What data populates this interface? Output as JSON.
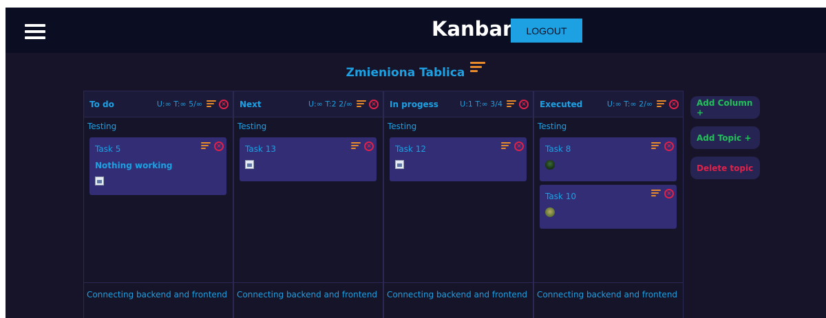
{
  "header": {
    "title": "Kanban",
    "logout_label": "LOGOUT"
  },
  "board": {
    "title": "Zmieniona Tablica"
  },
  "columns": [
    {
      "name": "To do",
      "stats": "U:∞ T:∞ 5/∞",
      "topics": [
        {
          "label": "Testing",
          "cards": [
            {
              "title": "Task 5",
              "description": "Nothing working"
            }
          ]
        },
        {
          "label": "Connecting backend and frontend",
          "cards": []
        }
      ]
    },
    {
      "name": "Next",
      "stats": "U:∞ T:2 2/∞",
      "topics": [
        {
          "label": "Testing",
          "cards": [
            {
              "title": "Task 13"
            }
          ]
        },
        {
          "label": "Connecting backend and frontend",
          "cards": []
        }
      ]
    },
    {
      "name": "In progess",
      "stats": "U:1 T:∞ 3/4",
      "topics": [
        {
          "label": "Testing",
          "cards": [
            {
              "title": "Task 12"
            }
          ]
        },
        {
          "label": "Connecting backend and frontend",
          "cards": []
        }
      ]
    },
    {
      "name": "Executed",
      "stats": "U:∞ T:∞ 2/∞",
      "topics": [
        {
          "label": "Testing",
          "cards": [
            {
              "title": "Task 8"
            },
            {
              "title": "Task 10"
            }
          ]
        },
        {
          "label": "Connecting backend and frontend",
          "cards": []
        }
      ]
    }
  ],
  "side_actions": {
    "add_column": "Add Column +",
    "add_topic": "Add Topic +",
    "delete_topic": "Delete topic"
  },
  "colors": {
    "background": "#171429",
    "topbar": "#0b0d22",
    "accent_blue": "#1da1e3",
    "menu_orange": "#e98b2b",
    "delete_red": "#e0214a",
    "add_green": "#21c15a",
    "card_bg": "#322d74"
  }
}
